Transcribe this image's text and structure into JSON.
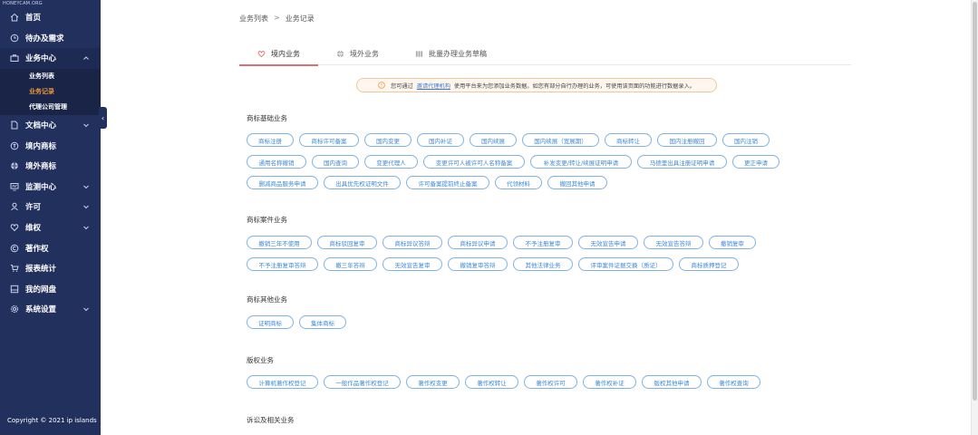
{
  "watermark": "HONEYCAM.ORG",
  "sidebar": {
    "items": [
      {
        "label": "首页",
        "icon": "home-icon"
      },
      {
        "label": "待办及需求",
        "icon": "clock-icon"
      },
      {
        "label": "业务中心",
        "icon": "briefcase-icon",
        "expanded": true,
        "children": [
          {
            "label": "业务列表",
            "active": false
          },
          {
            "label": "业务记录",
            "active": true
          },
          {
            "label": "代理公司管理",
            "active": false
          }
        ]
      },
      {
        "label": "文档中心",
        "icon": "document-icon",
        "has_children": true
      },
      {
        "label": "境内商标",
        "icon": "trademark-icon"
      },
      {
        "label": "境外商标",
        "icon": "globe-icon"
      },
      {
        "label": "监测中心",
        "icon": "monitor-icon",
        "has_children": true
      },
      {
        "label": "许可",
        "icon": "user-icon",
        "has_children": true
      },
      {
        "label": "维权",
        "icon": "heart-icon",
        "has_children": true
      },
      {
        "label": "著作权",
        "icon": "copyright-icon"
      },
      {
        "label": "报表统计",
        "icon": "cart-icon"
      },
      {
        "label": "我的网盘",
        "icon": "disk-icon"
      },
      {
        "label": "系统设置",
        "icon": "gear-icon",
        "has_children": true
      }
    ],
    "copyright": "Copyright © 2021 ip islands"
  },
  "breadcrumb": {
    "parent": "业务列表",
    "separator": ">",
    "current": "业务记录"
  },
  "tabs": [
    {
      "label": "境内业务",
      "icon": "heart-outline-icon",
      "active": true
    },
    {
      "label": "境外业务",
      "icon": "globe-icon",
      "active": false
    },
    {
      "label": "批量办理业务草稿",
      "icon": "batch-icon",
      "active": false
    }
  ],
  "notice": {
    "prefix": "您可通过",
    "link": "邀请代理机构",
    "suffix": "使用平台来为您添加业务数据。如您有部分自行办理的业务，可使用该页面的功能进行数据录入。"
  },
  "sections": [
    {
      "title": "商标基础业务",
      "rows": [
        [
          "商标注册",
          "商标许可备案",
          "国内变更",
          "国内补证",
          "国内续展",
          "国内续展（宽展期）",
          "商标转让",
          "国内注册撤回",
          "国内注销"
        ],
        [
          "通用名称撤销",
          "国内查询",
          "变更代理人",
          "变更许可人被许可人名称备案",
          "补发变更/转让/续展证明申请",
          "马德里出具注册证明申请",
          "更正申请"
        ],
        [
          "删减商品服务申请",
          "出具优先权证明文件",
          "许可备案提前终止备案",
          "代领材料",
          "撤回其他申请"
        ]
      ]
    },
    {
      "title": "商标案件业务",
      "rows": [
        [
          "撤销三年不使用",
          "商标驳回复审",
          "商标异议答辩",
          "商标异议申请",
          "不予注册复审",
          "无效宣告申请",
          "无效宣告答辩",
          "撤销复审"
        ],
        [
          "不予注册复审答辩",
          "撤三年答辩",
          "无效宣告复审",
          "撤销复审答辩",
          "其他法律业务",
          "评审案件证据交换（质证）",
          "商标质押登记"
        ]
      ]
    },
    {
      "title": "商标其他业务",
      "rows": [
        [
          "证明商标",
          "集体商标"
        ]
      ]
    },
    {
      "title": "版权业务",
      "rows": [
        [
          "计算机著作权登记",
          "一般作品著作权登记",
          "著作权变更",
          "著作权转让",
          "著作权许可",
          "著作权补证",
          "版权其他申请",
          "著作权查询"
        ]
      ]
    },
    {
      "title": "诉讼及相关业务",
      "rows": []
    }
  ],
  "colors": {
    "sidebar_bg": "#22305e",
    "active_sub": "#e8953c",
    "pill_border": "#7fb1e6",
    "pill_text": "#3f88d6",
    "tab_active_line": "#e07070"
  }
}
